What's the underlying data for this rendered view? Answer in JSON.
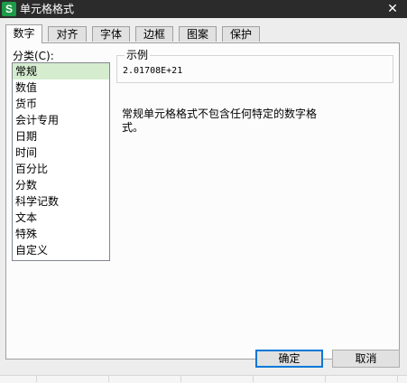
{
  "window": {
    "title": "单元格格式",
    "app_icon": "S",
    "close_glyph": "✕"
  },
  "tabs": [
    {
      "label": "数字",
      "active": true
    },
    {
      "label": "对齐",
      "active": false
    },
    {
      "label": "字体",
      "active": false
    },
    {
      "label": "边框",
      "active": false
    },
    {
      "label": "图案",
      "active": false
    },
    {
      "label": "保护",
      "active": false
    }
  ],
  "category": {
    "label": "分类(C):",
    "selected": "常规",
    "items": [
      "常规",
      "数值",
      "货币",
      "会计专用",
      "日期",
      "时间",
      "百分比",
      "分数",
      "科学记数",
      "文本",
      "特殊",
      "自定义"
    ]
  },
  "sample": {
    "legend": "示例",
    "value": "2.01708E+21"
  },
  "description": "常规单元格格式不包含任何特定的数字格式。",
  "buttons": {
    "ok": "确定",
    "cancel": "取消"
  },
  "colors": {
    "titlebar": "#2b2b2b",
    "selected_item": "#d5eccf",
    "app_icon": "#1e9b48"
  }
}
